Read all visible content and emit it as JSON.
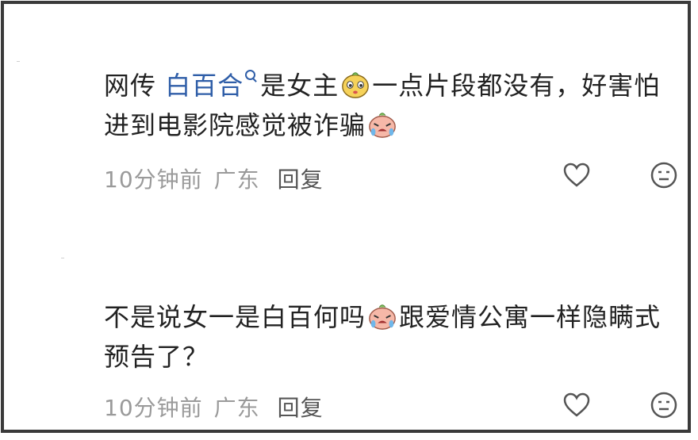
{
  "comments": [
    {
      "text_before": "网传 ",
      "mention": "白百合",
      "text_middle": "是女主",
      "emoji_1": "embarrassed-face-emoji",
      "text_after": "一点片段都没有，好害怕进到电影院感觉被诈骗",
      "emoji_2": "crying-face-emoji",
      "time": "10分钟前",
      "location": "广东",
      "reply": "回复"
    },
    {
      "text_before": "不是说女一是白百何吗",
      "emoji_1": "crying-face-emoji",
      "text_after": "跟爱情公寓一样隐瞒式预告了？",
      "time": "10分钟前",
      "location": "广东",
      "reply": "回复"
    }
  ],
  "icons": {
    "like": "heart-outline-icon",
    "dislike": "neutral-face-icon"
  },
  "colors": {
    "mention": "#2f5ea8",
    "meta": "#9a9a9a",
    "text": "#222222",
    "border": "#3a3a3a"
  }
}
